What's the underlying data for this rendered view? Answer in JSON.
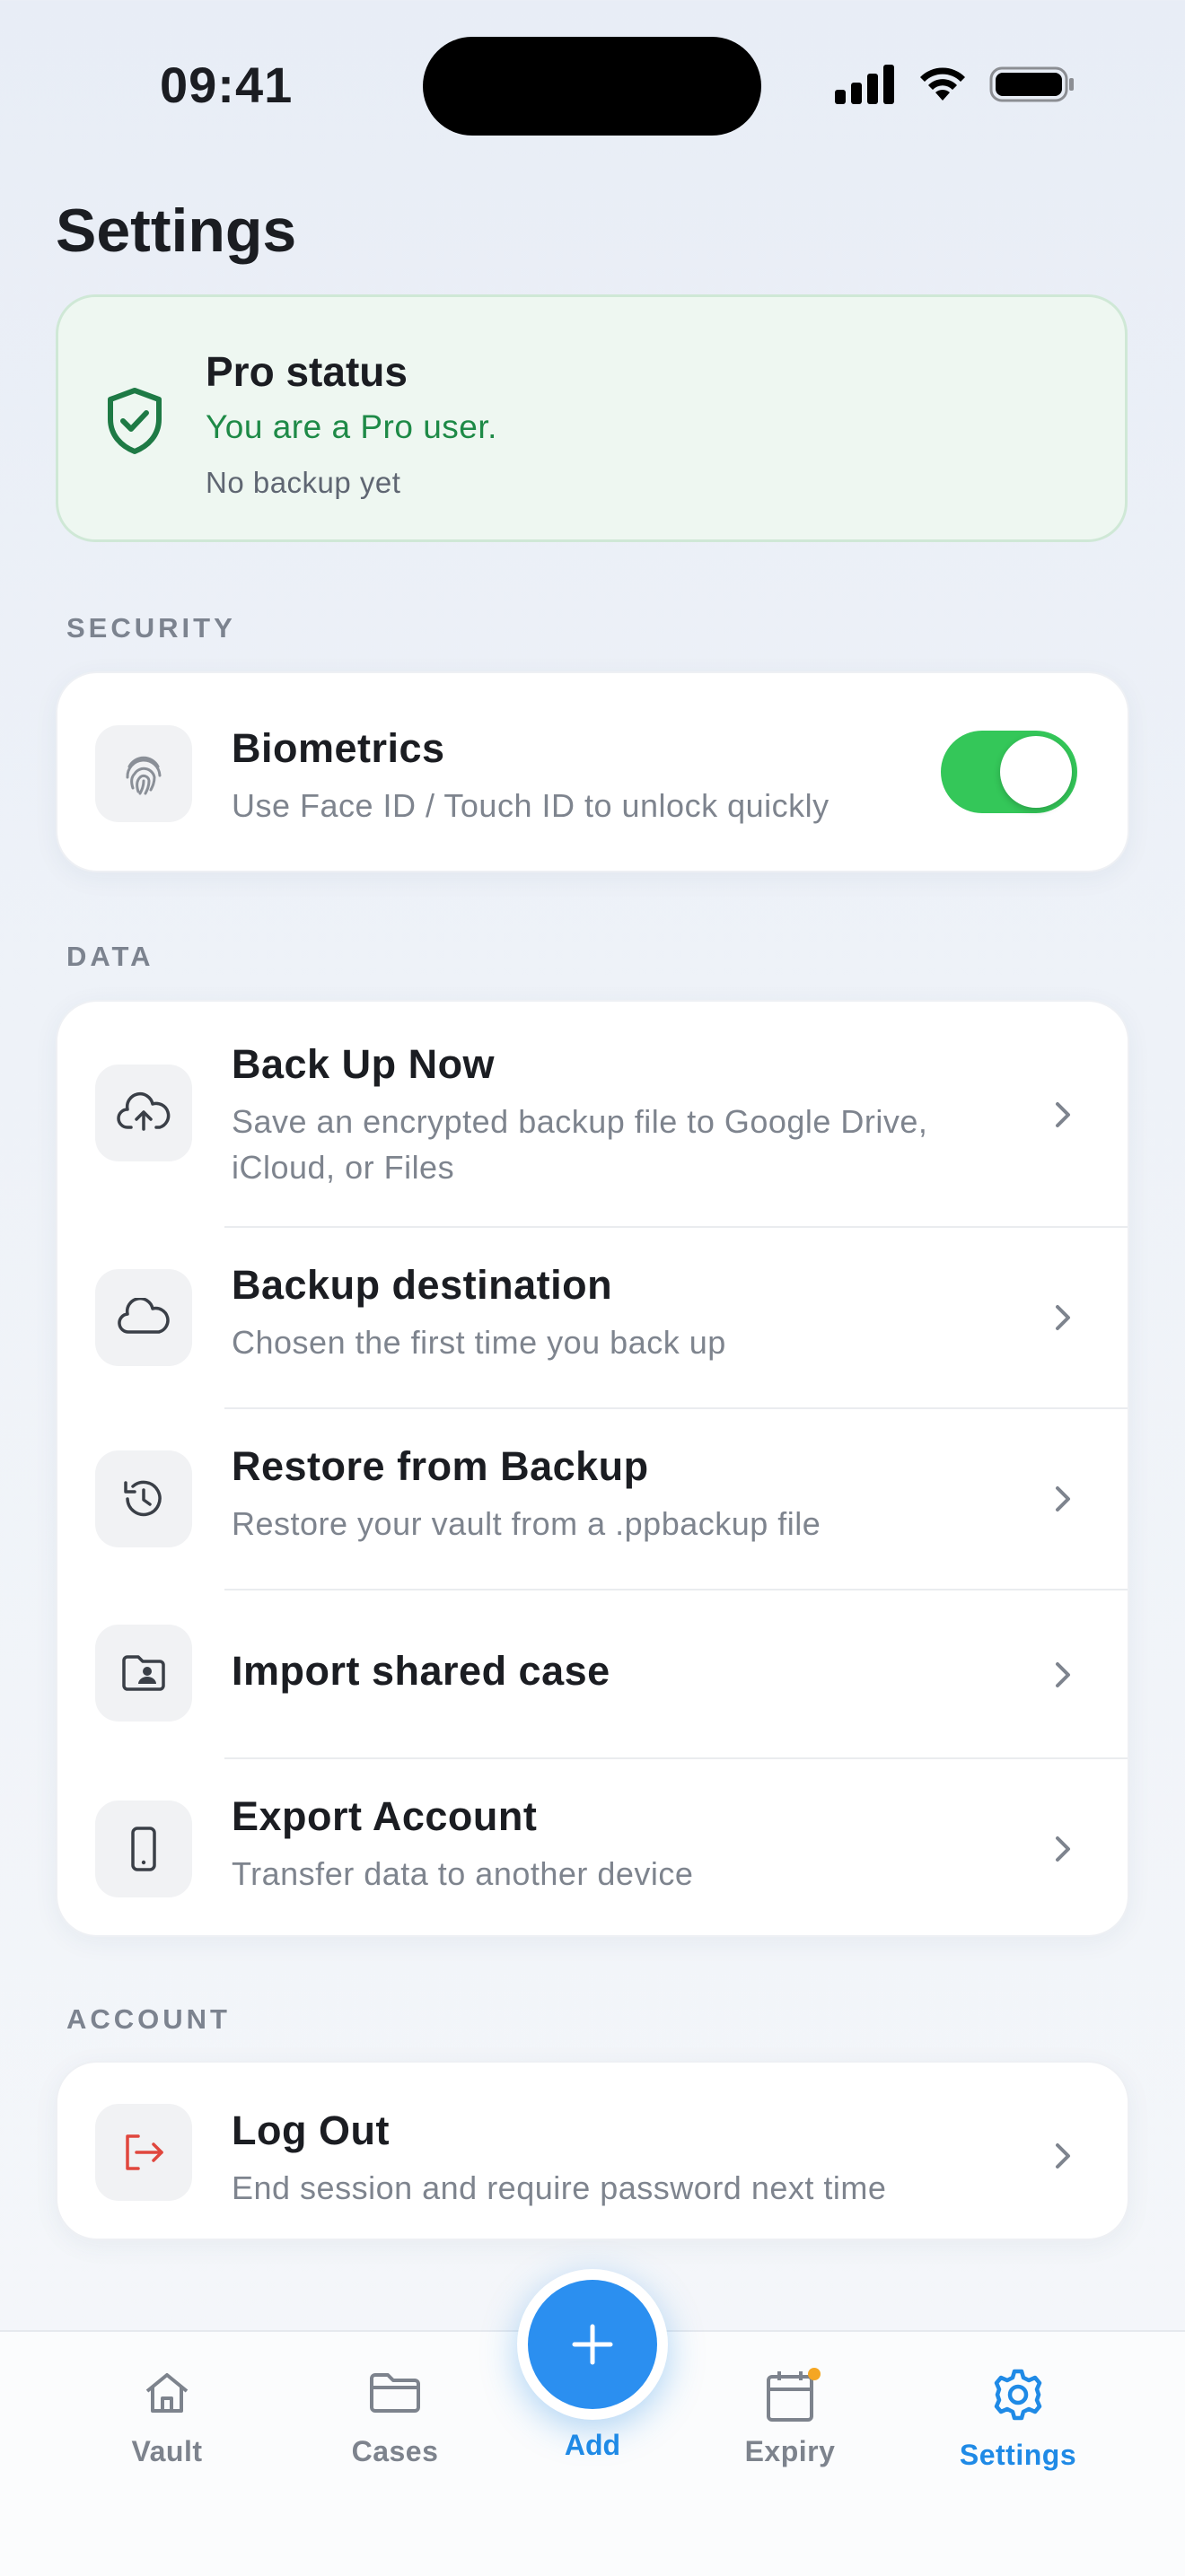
{
  "status_bar": {
    "time": "09:41"
  },
  "page": {
    "title": "Settings"
  },
  "pro_card": {
    "title": "Pro status",
    "status": "You are a Pro user.",
    "backup": "No backup yet",
    "icon": "shield-check-icon"
  },
  "sections": {
    "security": "SECURITY",
    "data": "DATA",
    "account": "ACCOUNT"
  },
  "security": {
    "biometrics": {
      "title": "Biometrics",
      "subtitle": "Use Face ID / Touch ID to unlock quickly",
      "enabled": true,
      "icon": "fingerprint-icon"
    }
  },
  "data_items": [
    {
      "title": "Back Up Now",
      "subtitle": "Save an encrypted backup file to Google Drive, iCloud, or Files",
      "icon": "cloud-upload-icon"
    },
    {
      "title": "Backup destination",
      "subtitle": "Chosen the first time you back up",
      "icon": "cloud-icon"
    },
    {
      "title": "Restore from Backup",
      "subtitle": "Restore your vault from a .ppbackup file",
      "icon": "history-icon"
    },
    {
      "title": "Import shared case",
      "subtitle": "",
      "icon": "folder-user-icon"
    },
    {
      "title": "Export Account",
      "subtitle": "Transfer data to another device",
      "icon": "phone-icon"
    }
  ],
  "account": {
    "logout": {
      "title": "Log Out",
      "subtitle": "End session and require password next time",
      "icon": "logout-icon"
    }
  },
  "nav": {
    "vault": "Vault",
    "cases": "Cases",
    "add": "Add",
    "expiry": "Expiry",
    "settings": "Settings",
    "active": "settings"
  },
  "colors": {
    "accent": "#2b8ff0",
    "toggle_on": "#34c759",
    "pro_green": "#1e8a47",
    "logout_red": "#e0463d"
  }
}
